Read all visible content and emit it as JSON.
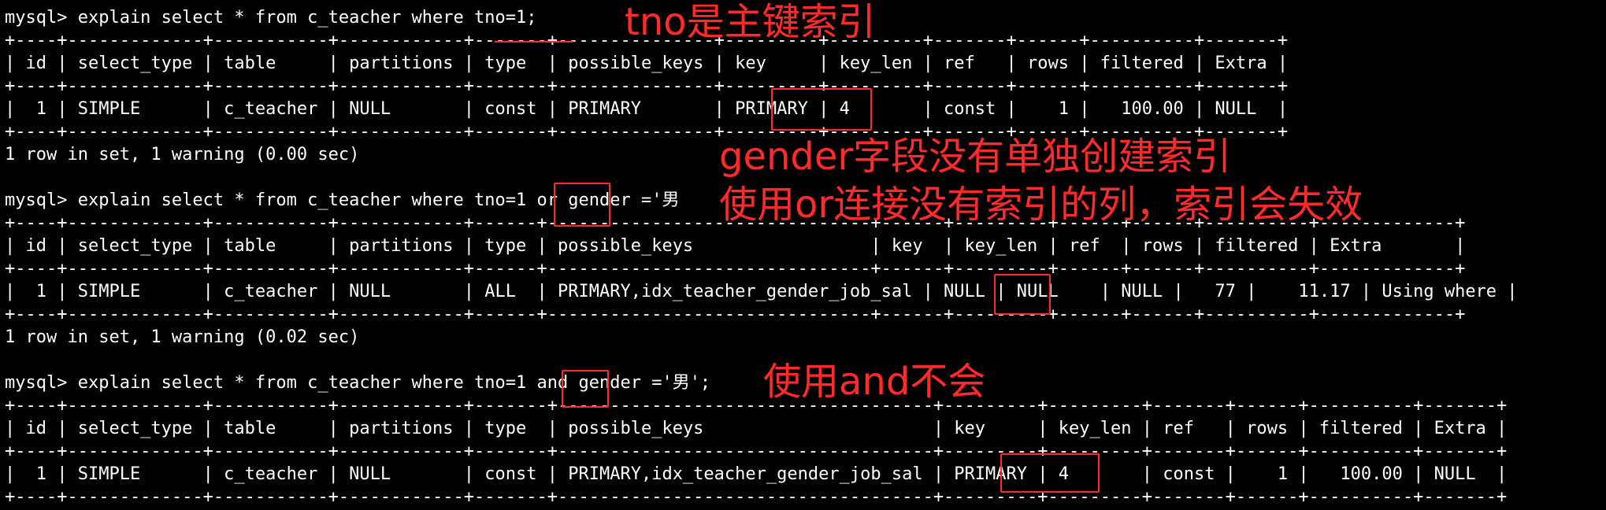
{
  "terminal": {
    "lines": [
      "mysql> explain select * from c_teacher where tno=1;",
      "+----+-------------+-----------+------------+-------+---------------+---------+---------+-------+------+----------+-------+",
      "| id | select_type | table     | partitions | type  | possible_keys | key     | key_len | ref   | rows | filtered | Extra |",
      "+----+-------------+-----------+------------+-------+---------------+---------+---------+-------+------+----------+-------+",
      "|  1 | SIMPLE      | c_teacher | NULL       | const | PRIMARY       | PRIMARY | 4       | const |    1 |   100.00 | NULL  |",
      "+----+-------------+-----------+------------+-------+---------------+---------+---------+-------+------+----------+-------+",
      "1 row in set, 1 warning (0.00 sec)",
      "",
      "mysql> explain select * from c_teacher where tno=1 or gender ='男",
      "+----+-------------+-----------+------------+------+-------------------------------+------+---------+------+------+----------+-------------+",
      "| id | select_type | table     | partitions | type | possible_keys                 | key  | key_len | ref  | rows | filtered | Extra       |",
      "+----+-------------+-----------+------------+------+-------------------------------+------+---------+------+------+----------+-------------+",
      "|  1 | SIMPLE      | c_teacher | NULL       | ALL  | PRIMARY,idx_teacher_gender_job_sal | NULL | NULL    | NULL |   77 |    11.17 | Using where |",
      "+----+-------------+-----------+------------+------+-------------------------------+------+---------+------+------+----------+-------------+",
      "1 row in set, 1 warning (0.02 sec)",
      "",
      "mysql> explain select * from c_teacher where tno=1 and gender ='男';",
      "+----+-------------+-----------+------------+-------+------------------------------------+---------+---------+-------+------+----------+-------+",
      "| id | select_type | table     | partitions | type  | possible_keys                      | key     | key_len | ref   | rows | filtered | Extra |",
      "+----+-------------+-----------+------------+-------+------------------------------------+---------+---------+-------+------+----------+-------+",
      "|  1 | SIMPLE      | c_teacher | NULL       | const | PRIMARY,idx_teacher_gender_job_sal | PRIMARY | 4       | const |    1 |   100.00 | NULL  |",
      "+----+-------------+-----------+------------+-------+------------------------------------+---------+---------+-------+------+----------+-------+"
    ]
  },
  "annotations": {
    "primary_key_note": "tno是主键索引",
    "gender_no_index_note": "gender字段没有单独创建索引",
    "or_invalidates_note": "使用or连接没有索引的列，索引会失效",
    "and_ok_note": "使用and不会"
  },
  "colors": {
    "background": "#000000",
    "text": "#ffffff",
    "annotation": "#ff2a2a"
  }
}
